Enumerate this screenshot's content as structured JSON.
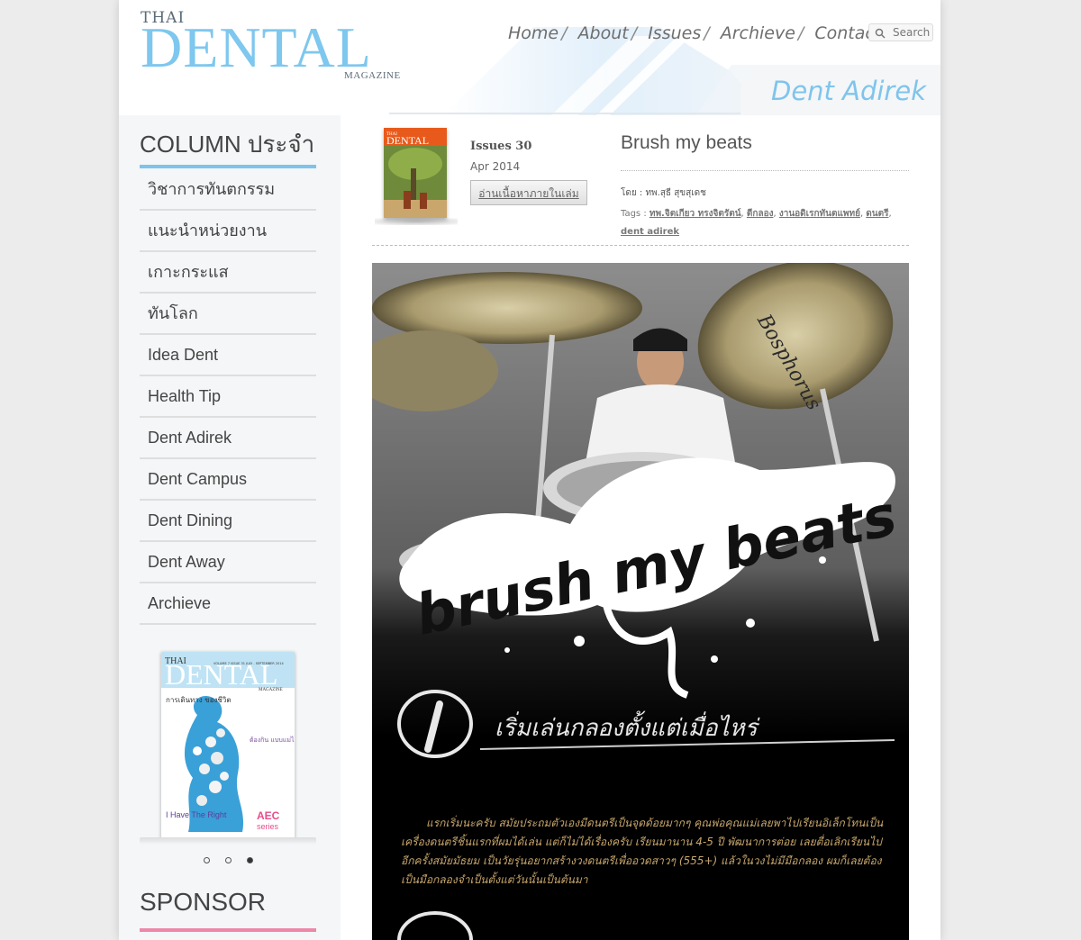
{
  "brand": {
    "line1": "THAI",
    "line2": "DENTAL",
    "line3": "MAGAZINE"
  },
  "nav": {
    "items": [
      "Home",
      "About",
      "Issues",
      "Archieve",
      "Contact"
    ]
  },
  "search": {
    "label": "Search"
  },
  "section_title": "Dent Adirek",
  "sidebar": {
    "column_title": "COLUMN ประจำ",
    "items": [
      "วิชาการทันตกรรม",
      "แนะนำหน่วยงาน",
      "เกาะกระแส",
      "ทันโลก",
      "Idea Dent",
      "Health Tip",
      "Dent Adirek",
      "Dent Campus",
      "Dent Dining",
      "Dent Away",
      "Archieve"
    ],
    "cover": {
      "thai": "THAI",
      "dental": "DENTAL",
      "magazine": "MAGAZINE",
      "volume": "VOLUME 7 ISSUE 31 JULY - SEPTEMBER 2014",
      "headline": "การเดินทาง ของชีวิต",
      "subheadline": "ต้องกิน แบบแม่ได้",
      "left_caption": "I Have The Right",
      "aec": "AEC",
      "series": "series"
    },
    "carousel_active": 3,
    "sponsor_title": "SPONSOR"
  },
  "issue": {
    "number": "Issues 30",
    "date": "Apr 2014",
    "read_button": "อ่านเนื้อหาภายในเล่ม",
    "cover_brand": "DENTAL",
    "cover_thai": "THAI"
  },
  "article": {
    "title": "Brush my beats",
    "author": "โดย : ทพ.สุธี สุขสุเดช",
    "tags_label": "Tags :",
    "tags": [
      "ทพ.จิตเกียว ทรงจิตรัตน์",
      "ตีกลอง",
      "งานอดิเรกทันตแพทย์",
      "ดนตรี",
      "dent adirek"
    ],
    "hero_logo_text": "brush my beats",
    "hero_heading": "เริ่มเล่นกลองตั้งแต่เมื่อไหร่",
    "hero_paragraph": "แรกเริ่มนะครับ สมัยประถมตัวเองมีดนตรีเป็นจุดด้อยมากๆ คุณพ่อคุณแม่เลยพาไปเรียนอิเล็กโทนเป็นเครื่องดนตรีชิ้นแรกที่ผมได้เล่น แต่ก็ไม่ได้เรื่องครับ เรียนมานาน 4-5 ปี พัฒนาการต่อย เลยตื่อเลิกเรียนไปอีกครั้งสมัยมัธยม เป็นวัยรุ่นอยากสร้างวงดนตรีเพื่ออวดสาวๆ (555+) แล้วในวงไม่มีมือกลอง ผมก็เลยต้องเป็นมือกลองจำเป็นตั้งแต่วันนั้นเป็นต้นมา",
    "cymbal_brand": "Bosphorus"
  }
}
